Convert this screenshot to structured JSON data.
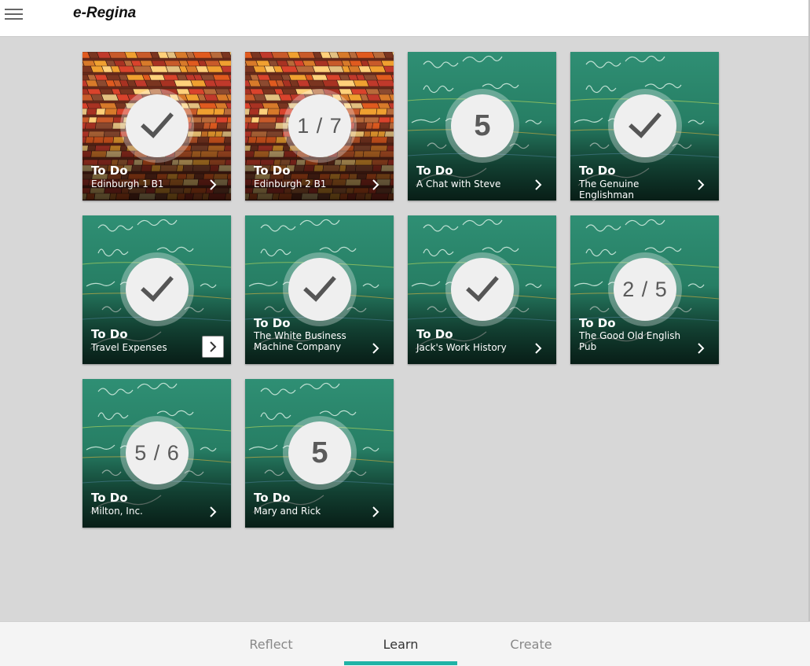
{
  "app": {
    "title": "e-Regina"
  },
  "colors": {
    "accent": "#1fb3a6",
    "background": "#d7d7d7",
    "header": "#ffffff"
  },
  "icons": {
    "menu": "hamburger-icon",
    "done": "checkmark-icon",
    "open": "chevron-right-icon"
  },
  "tiles": [
    {
      "status": "To Do",
      "name": "Edinburgh 1 B1",
      "image": "books",
      "badge": {
        "type": "check"
      }
    },
    {
      "status": "To Do",
      "name": "Edinburgh 2 B1",
      "image": "books",
      "badge": {
        "type": "progress",
        "text": "1 / 7"
      }
    },
    {
      "status": "To Do",
      "name": "A Chat with Steve",
      "image": "chalkboard",
      "badge": {
        "type": "count",
        "text": "5"
      }
    },
    {
      "status": "To Do",
      "name": "The Genuine Englishman",
      "image": "chalkboard",
      "badge": {
        "type": "check"
      }
    },
    {
      "status": "To Do",
      "name": "Travel Expenses",
      "image": "chalkboard",
      "badge": {
        "type": "check"
      },
      "focused": true
    },
    {
      "status": "To Do",
      "name": "The White Business Machine Company",
      "image": "chalkboard",
      "badge": {
        "type": "check"
      }
    },
    {
      "status": "To Do",
      "name": "Jack's Work History",
      "image": "chalkboard",
      "badge": {
        "type": "check"
      }
    },
    {
      "status": "To Do",
      "name": "The Good Old English Pub",
      "image": "chalkboard",
      "badge": {
        "type": "progress",
        "text": "2 / 5"
      }
    },
    {
      "status": "To Do",
      "name": "Milton, Inc.",
      "image": "chalkboard",
      "badge": {
        "type": "progress",
        "text": "5 / 6"
      }
    },
    {
      "status": "To Do",
      "name": "Mary and Rick",
      "image": "chalkboard",
      "badge": {
        "type": "count",
        "text": "5"
      }
    }
  ],
  "bottom_nav": {
    "tabs": [
      {
        "label": "Reflect"
      },
      {
        "label": "Learn",
        "active": true
      },
      {
        "label": "Create"
      }
    ]
  }
}
